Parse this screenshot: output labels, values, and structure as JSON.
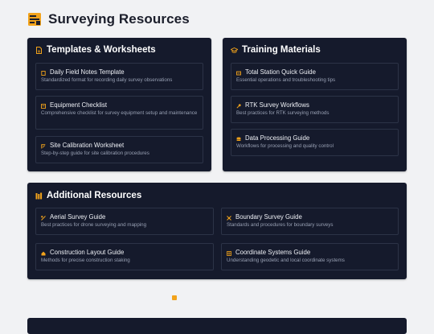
{
  "header": {
    "title": "Surveying Resources",
    "logo_icon": "survey-folder-icon"
  },
  "colors": {
    "accent": "#f2a31b",
    "panel": "#151a2c",
    "card_border": "#2c3347",
    "background": "#f1f2f4"
  },
  "templates": {
    "title": "Templates & Worksheets",
    "icon": "document-icon",
    "items": [
      {
        "title": "Daily Field Notes Template",
        "desc": "Standardized format for recording daily survey observations",
        "icon": "notebook-icon"
      },
      {
        "title": "Equipment Checklist",
        "desc": "Comprehensive checklist for survey equipment setup and maintenance",
        "icon": "checklist-icon"
      },
      {
        "title": "Site Calibration Worksheet",
        "desc": "Step-by-step guide for site calibration procedures",
        "icon": "calibration-icon"
      }
    ]
  },
  "training": {
    "title": "Training Materials",
    "icon": "graduation-cap-icon",
    "items": [
      {
        "title": "Total Station Quick Guide",
        "desc": "Essential operations and troubleshooting tips",
        "icon": "total-station-icon"
      },
      {
        "title": "RTK Survey Workflows",
        "desc": "Best practices for RTK surveying methods",
        "icon": "satellite-icon"
      },
      {
        "title": "Data Processing Guide",
        "desc": "Workflows for processing and quality control",
        "icon": "database-icon"
      }
    ]
  },
  "additional": {
    "title": "Additional Resources",
    "icon": "library-icon",
    "items": [
      {
        "title": "Aerial Survey Guide",
        "desc": "Best practices for drone surveying and mapping",
        "icon": "drone-icon"
      },
      {
        "title": "Boundary Survey Guide",
        "desc": "Standards and procedures for boundary surveys",
        "icon": "boundary-icon"
      },
      {
        "title": "Construction Layout Guide",
        "desc": "Methods for precise construction staking",
        "icon": "house-icon"
      },
      {
        "title": "Coordinate Systems Guide",
        "desc": "Understanding geodetic and local coordinate systems",
        "icon": "grid-icon"
      }
    ]
  }
}
